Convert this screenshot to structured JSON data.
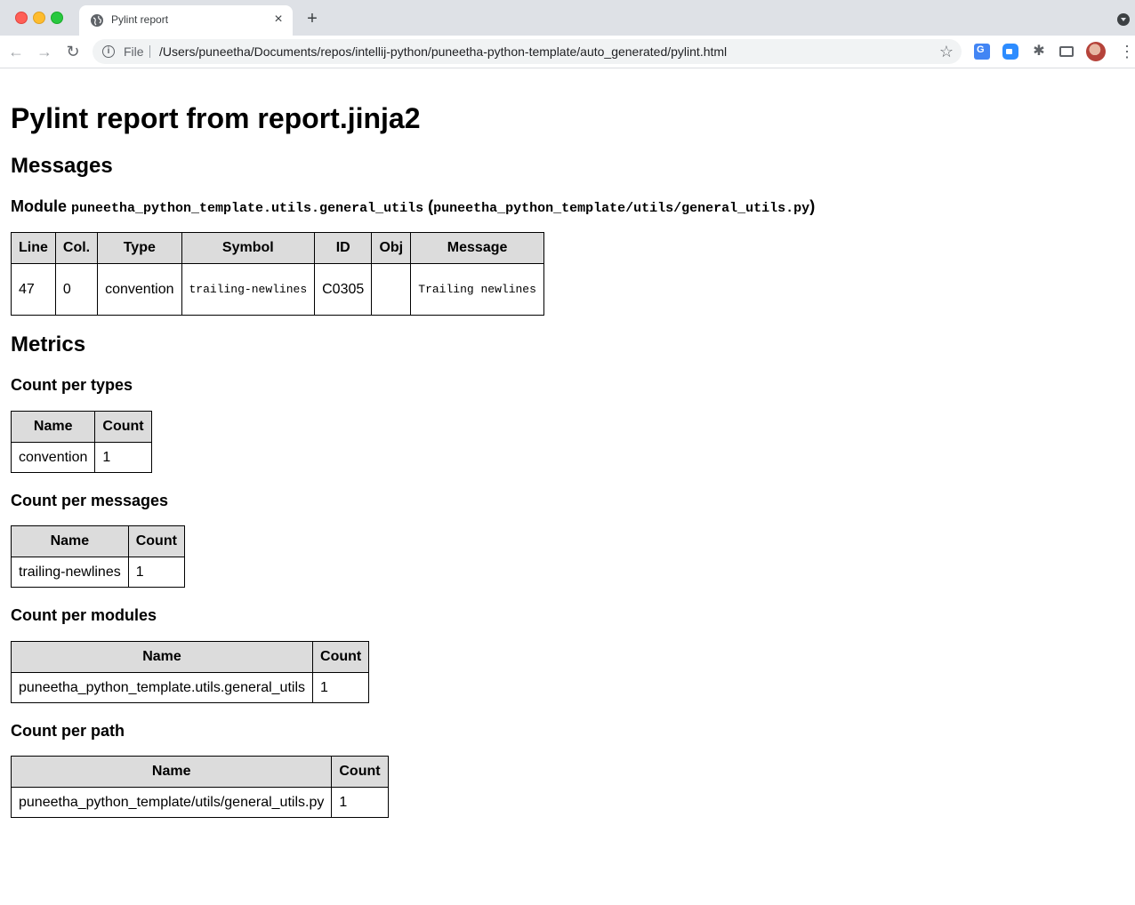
{
  "browser": {
    "tab_title": "Pylint report",
    "new_tab": "+",
    "tab_close": "×",
    "scheme_label": "File",
    "url": "/Users/puneetha/Documents/repos/intellij-python/puneetha-python-template/auto_generated/pylint.html"
  },
  "page": {
    "title": "Pylint report from report.jinja2",
    "messages_heading": "Messages",
    "module_prefix": "Module",
    "module_name": "puneetha_python_template.utils.general_utils",
    "module_path_open": "(",
    "module_path": "puneetha_python_template/utils/general_utils.py",
    "module_path_close": ")",
    "metrics_heading": "Metrics"
  },
  "messages_table": {
    "headers": [
      "Line",
      "Col.",
      "Type",
      "Symbol",
      "ID",
      "Obj",
      "Message"
    ],
    "rows": [
      [
        "47",
        "0",
        "convention",
        "trailing-newlines",
        "C0305",
        "",
        "Trailing newlines"
      ]
    ]
  },
  "count_per_types": {
    "heading": "Count per types",
    "headers": [
      "Name",
      "Count"
    ],
    "rows": [
      [
        "convention",
        "1"
      ]
    ]
  },
  "count_per_messages": {
    "heading": "Count per messages",
    "headers": [
      "Name",
      "Count"
    ],
    "rows": [
      [
        "trailing-newlines",
        "1"
      ]
    ]
  },
  "count_per_modules": {
    "heading": "Count per modules",
    "headers": [
      "Name",
      "Count"
    ],
    "rows": [
      [
        "puneetha_python_template.utils.general_utils",
        "1"
      ]
    ]
  },
  "count_per_path": {
    "heading": "Count per path",
    "headers": [
      "Name",
      "Count"
    ],
    "rows": [
      [
        "puneetha_python_template/utils/general_utils.py",
        "1"
      ]
    ]
  }
}
